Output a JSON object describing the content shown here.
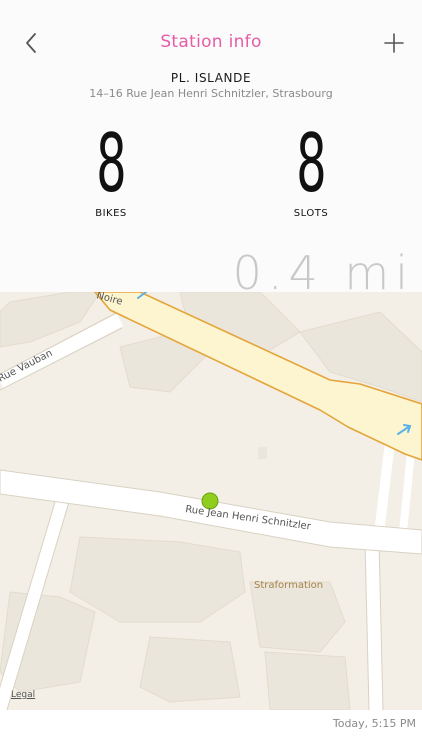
{
  "header": {
    "title": "Station info",
    "back_icon": "chevron-left-icon",
    "add_icon": "plus-icon",
    "accent_color": "#e55da6"
  },
  "station": {
    "name": "PL. ISLANDE",
    "address": "14–16 Rue Jean Henri Schnitzler, Strasbourg"
  },
  "availability": {
    "bikes_value": "8",
    "bikes_label": "BIKES",
    "slots_value": "8",
    "slots_label": "SLOTS"
  },
  "distance": "0.4 mi",
  "map": {
    "labels": {
      "street_main": "Rue Jean Henri Schnitzler",
      "street_vauban": "Rue Vauban",
      "street_top": "Noire",
      "poi": "Straformation"
    },
    "legal": "Legal",
    "marker_color": "#8fce1e"
  },
  "footer": {
    "timestamp": "Today, 5:15 PM"
  }
}
